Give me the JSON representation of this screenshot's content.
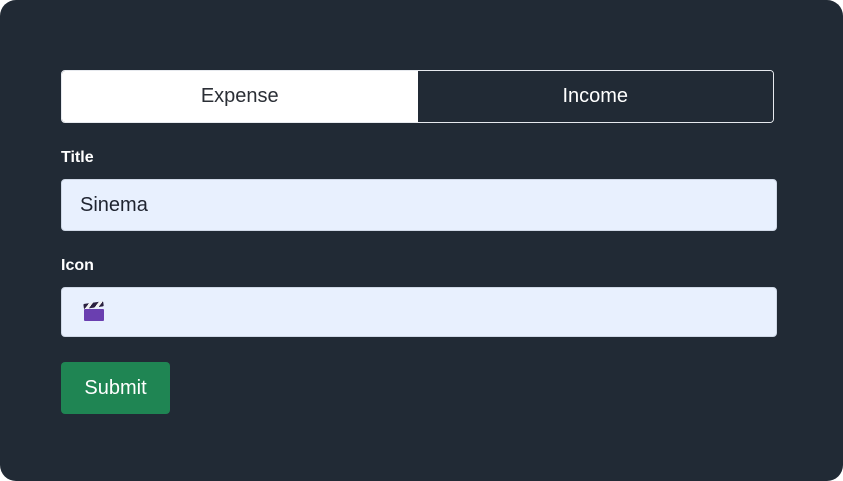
{
  "toggle": {
    "expense_label": "Expense",
    "income_label": "Income",
    "selected": "Expense"
  },
  "form": {
    "title_label": "Title",
    "title_value": "Sinema",
    "icon_label": "Icon",
    "icon_value": "🎬",
    "icon_name": "clapper-board-icon",
    "submit_label": "Submit"
  },
  "colors": {
    "panel_bg": "#212a35",
    "input_bg": "#e8f0fe",
    "submit_bg": "#1f8553"
  }
}
